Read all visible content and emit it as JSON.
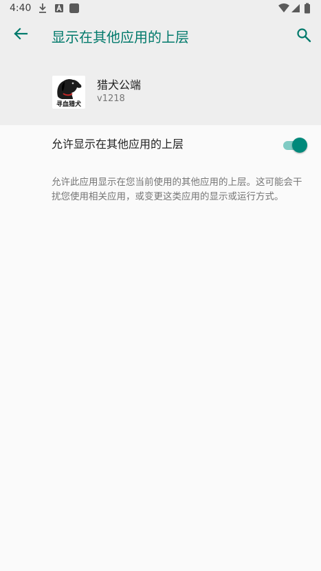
{
  "status_bar": {
    "time": "4:40",
    "icons": [
      "download-icon",
      "a-badge-icon",
      "square-icon",
      "wifi-icon",
      "signal-icon",
      "battery-icon"
    ]
  },
  "app_bar": {
    "title": "显示在其他应用的上层",
    "back_icon": "arrow-left-icon",
    "search_icon": "search-icon"
  },
  "app_info": {
    "name": "猎犬公端",
    "version": "v1218",
    "icon_label": "寻血猎犬"
  },
  "setting": {
    "label": "允许显示在其他应用的上层",
    "enabled": true,
    "description": "允许此应用显示在您当前使用的其他应用的上层。这可能会干扰您使用相关应用，或变更这类应用的显示或运行方式。"
  },
  "colors": {
    "accent": "#00796b",
    "toggle_thumb": "#00897b",
    "toggle_track": "#80cbc4",
    "header_bg": "#eeeeee",
    "page_bg": "#fafafa"
  }
}
